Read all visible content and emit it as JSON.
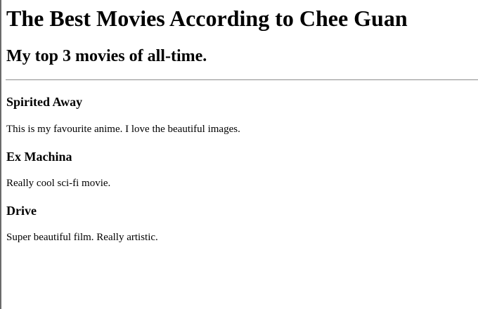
{
  "page": {
    "title": "The Best Movies According to Chee Guan",
    "subtitle": "My top 3 movies of all-time."
  },
  "movies": [
    {
      "name": "Spirited Away",
      "description": "This is my favourite anime. I love the beautiful images."
    },
    {
      "name": "Ex Machina",
      "description": "Really cool sci-fi movie."
    },
    {
      "name": "Drive",
      "description": "Super beautiful film. Really artistic."
    }
  ]
}
